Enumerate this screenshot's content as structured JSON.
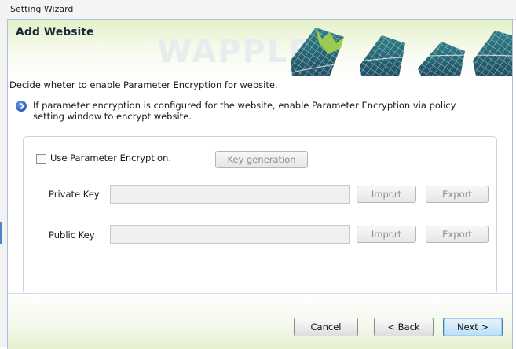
{
  "window": {
    "title": "Setting Wizard"
  },
  "header": {
    "heading": "Add Website",
    "watermark": "WAPPLEX"
  },
  "description": "Decide wheter to enable Parameter Encryption for website.",
  "info": {
    "text": "If parameter encryption is configured for the website, enable Parameter Encryption via policy setting window to encrypt website."
  },
  "encryption": {
    "checkbox_label": "Use Parameter Encryption.",
    "checked": false,
    "keygen_label": "Key generation",
    "private_key": {
      "label": "Private Key",
      "value": "",
      "import_label": "Import",
      "export_label": "Export"
    },
    "public_key": {
      "label": "Public Key",
      "value": "",
      "import_label": "Import",
      "export_label": "Export"
    }
  },
  "footer": {
    "cancel_label": "Cancel",
    "back_label": "< Back",
    "next_label": "Next >"
  },
  "colors": {
    "header_green": "#e3f1c7",
    "accent_green": "#a6d24a",
    "primary_blue": "#3c7fb1"
  }
}
